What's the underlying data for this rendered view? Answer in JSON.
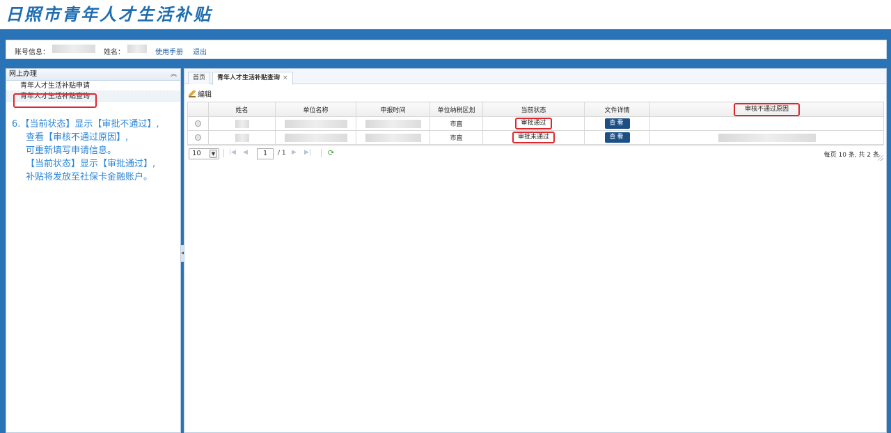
{
  "app": {
    "title": "日照市青年人才生活补贴"
  },
  "info_bar": {
    "account_label": "账号信息：",
    "name_label": "姓名：",
    "manual_link": "使用手册",
    "logout_link": "退出"
  },
  "sidebar": {
    "title": "网上办理",
    "collapse_icon": "double-chevron-up-icon",
    "items": [
      {
        "label": "青年人才生活补贴申请"
      },
      {
        "label": "青年人才生活补贴查询"
      }
    ]
  },
  "instruction_note": {
    "lines": [
      "6.【当前状态】显示【审批不通过】,",
      "查看【审核不通过原因】,",
      "可重新填写申请信息。",
      "【当前状态】显示【审批通过】,",
      "补贴将发放至社保卡金融账户。"
    ]
  },
  "tabs": [
    {
      "label": "首页"
    },
    {
      "label": "青年人才生活补贴查询",
      "close": "×"
    }
  ],
  "toolbar": {
    "edit_label": "编辑",
    "edit_icon": "pencil-icon"
  },
  "grid": {
    "columns": [
      "姓名",
      "单位名称",
      "申报时间",
      "单位纳税区划",
      "当前状态",
      "文件详情",
      "审核不通过原因"
    ],
    "rows": [
      {
        "district": "市直",
        "status": "审批通过",
        "detail_button": "查看"
      },
      {
        "district": "市直",
        "status": "审批未通过",
        "detail_button": "查看"
      }
    ]
  },
  "pager": {
    "page_size": "10",
    "current_page": "1",
    "total_pages": "/ 1",
    "summary": "每页 10 条, 共 2 条"
  },
  "colors": {
    "frame_blue": "#2a73b7",
    "highlight_red": "#e0262d",
    "note_blue": "#2c86d6",
    "button_navy": "#1c4f83"
  }
}
